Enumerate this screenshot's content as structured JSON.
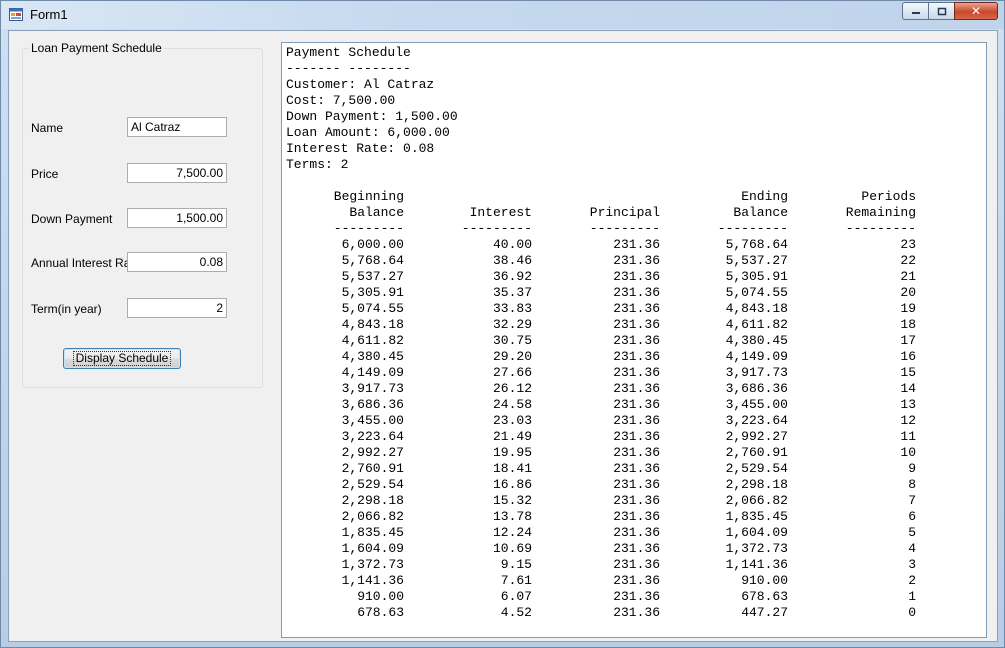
{
  "window": {
    "title": "Form1",
    "min_label": "▭",
    "max_label": "▢",
    "close_label": "✕"
  },
  "groupbox": {
    "title": "Loan Payment Schedule"
  },
  "fields": {
    "name_label": "Name",
    "name_value": "Al Catraz",
    "price_label": "Price",
    "price_value": "7,500.00",
    "down_label": "Down Payment",
    "down_value": "1,500.00",
    "rate_label": "Annual Interest Rate",
    "rate_value": "0.08",
    "term_label": "Term(in year)",
    "term_value": "2"
  },
  "button": {
    "display_label": "Display Schedule"
  },
  "output": {
    "header": [
      "Payment Schedule",
      "------- --------",
      "Customer: Al Catraz",
      "Cost: 7,500.00",
      "Down Payment: 1,500.00",
      "Loan Amount: 6,000.00",
      "Interest Rate: 0.08",
      "Terms: 2"
    ],
    "columns_line1": [
      "Beginning",
      "",
      "",
      "Ending",
      "Periods"
    ],
    "columns_line2": [
      "Balance",
      "Interest",
      "Principal",
      "Balance",
      "Remaining"
    ],
    "separator": [
      "---------",
      "---------",
      "---------",
      "---------",
      "---------"
    ],
    "rows": [
      [
        "6,000.00",
        "40.00",
        "231.36",
        "5,768.64",
        "23"
      ],
      [
        "5,768.64",
        "38.46",
        "231.36",
        "5,537.27",
        "22"
      ],
      [
        "5,537.27",
        "36.92",
        "231.36",
        "5,305.91",
        "21"
      ],
      [
        "5,305.91",
        "35.37",
        "231.36",
        "5,074.55",
        "20"
      ],
      [
        "5,074.55",
        "33.83",
        "231.36",
        "4,843.18",
        "19"
      ],
      [
        "4,843.18",
        "32.29",
        "231.36",
        "4,611.82",
        "18"
      ],
      [
        "4,611.82",
        "30.75",
        "231.36",
        "4,380.45",
        "17"
      ],
      [
        "4,380.45",
        "29.20",
        "231.36",
        "4,149.09",
        "16"
      ],
      [
        "4,149.09",
        "27.66",
        "231.36",
        "3,917.73",
        "15"
      ],
      [
        "3,917.73",
        "26.12",
        "231.36",
        "3,686.36",
        "14"
      ],
      [
        "3,686.36",
        "24.58",
        "231.36",
        "3,455.00",
        "13"
      ],
      [
        "3,455.00",
        "23.03",
        "231.36",
        "3,223.64",
        "12"
      ],
      [
        "3,223.64",
        "21.49",
        "231.36",
        "2,992.27",
        "11"
      ],
      [
        "2,992.27",
        "19.95",
        "231.36",
        "2,760.91",
        "10"
      ],
      [
        "2,760.91",
        "18.41",
        "231.36",
        "2,529.54",
        "9"
      ],
      [
        "2,529.54",
        "16.86",
        "231.36",
        "2,298.18",
        "8"
      ],
      [
        "2,298.18",
        "15.32",
        "231.36",
        "2,066.82",
        "7"
      ],
      [
        "2,066.82",
        "13.78",
        "231.36",
        "1,835.45",
        "6"
      ],
      [
        "1,835.45",
        "12.24",
        "231.36",
        "1,604.09",
        "5"
      ],
      [
        "1,604.09",
        "10.69",
        "231.36",
        "1,372.73",
        "4"
      ],
      [
        "1,372.73",
        "9.15",
        "231.36",
        "1,141.36",
        "3"
      ],
      [
        "1,141.36",
        "7.61",
        "231.36",
        "910.00",
        "2"
      ],
      [
        "910.00",
        "6.07",
        "231.36",
        "678.63",
        "1"
      ],
      [
        "678.63",
        "4.52",
        "231.36",
        "447.27",
        "0"
      ]
    ]
  }
}
